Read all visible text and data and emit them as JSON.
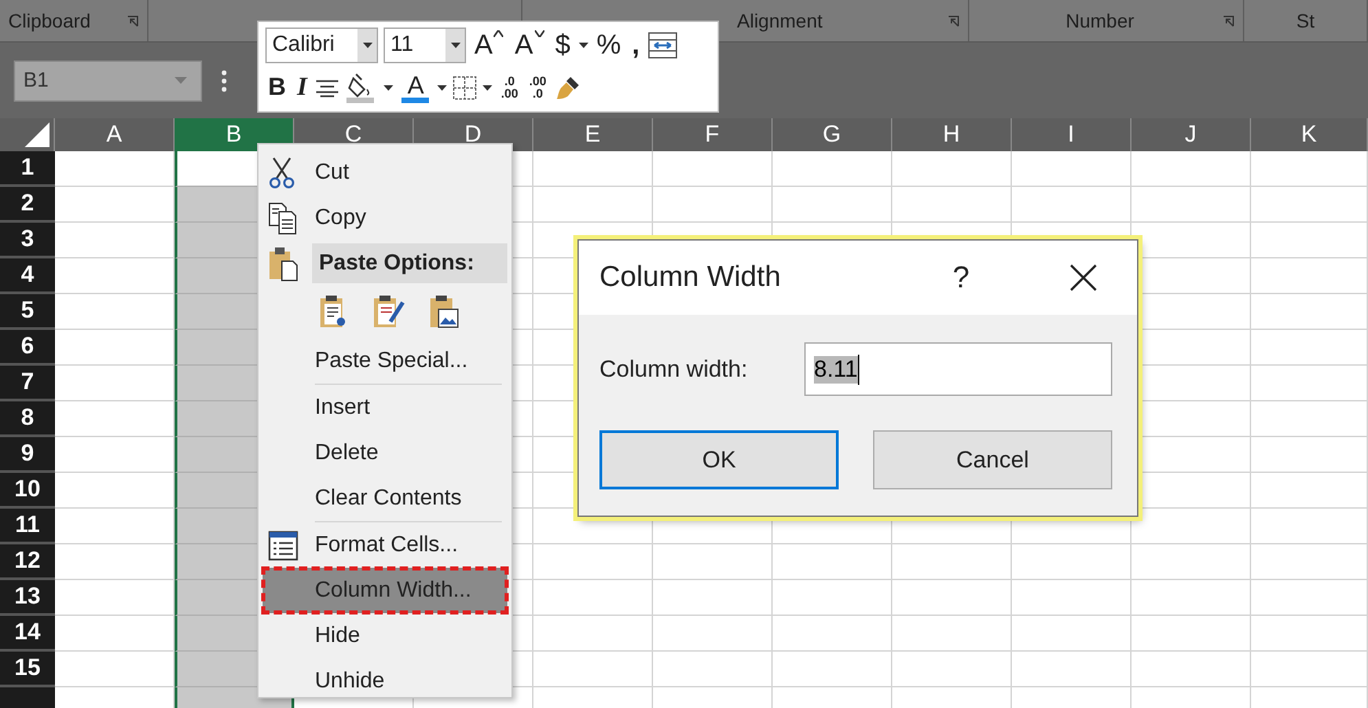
{
  "ribbon_groups": [
    {
      "label": "Clipboard",
      "launcher": true
    },
    {
      "label": "Alignment",
      "launcher": true
    },
    {
      "label": "Number",
      "launcher": true
    },
    {
      "label": "St",
      "launcher": false
    }
  ],
  "name_box": {
    "value": "B1"
  },
  "mini_toolbar": {
    "font": "Calibri",
    "size": "11",
    "grow_font": "A",
    "shrink_font": "A",
    "currency": "$",
    "percent": "%",
    "comma": ",",
    "bold": "B",
    "italic": "I",
    "font_color": "A",
    "increase_decimal": {
      "top": ".0",
      "bottom": ".00"
    },
    "decrease_decimal": {
      "top": ".00",
      "bottom": ".0"
    }
  },
  "columns": [
    {
      "label": "A",
      "selected": false
    },
    {
      "label": "B",
      "selected": true
    },
    {
      "label": "C",
      "selected": false
    },
    {
      "label": "D",
      "selected": false
    },
    {
      "label": "E",
      "selected": false
    },
    {
      "label": "F",
      "selected": false
    },
    {
      "label": "G",
      "selected": false
    },
    {
      "label": "H",
      "selected": false
    },
    {
      "label": "I",
      "selected": false
    },
    {
      "label": "J",
      "selected": false
    },
    {
      "label": "K",
      "selected": false
    }
  ],
  "rows": [
    {
      "label": "1",
      "active": true
    },
    {
      "label": "2",
      "active": false
    },
    {
      "label": "3",
      "active": false
    },
    {
      "label": "4",
      "active": false
    },
    {
      "label": "5",
      "active": false
    },
    {
      "label": "6",
      "active": false
    },
    {
      "label": "7",
      "active": false
    },
    {
      "label": "8",
      "active": false
    },
    {
      "label": "9",
      "active": false
    },
    {
      "label": "10",
      "active": false
    },
    {
      "label": "11",
      "active": false
    },
    {
      "label": "12",
      "active": false
    },
    {
      "label": "13",
      "active": false
    },
    {
      "label": "14",
      "active": false
    },
    {
      "label": "15",
      "active": false
    }
  ],
  "context_menu": {
    "items": [
      {
        "kind": "cut",
        "label": "Cut",
        "divider_before": false,
        "selected": false
      },
      {
        "kind": "copy",
        "label": "Copy",
        "divider_before": false,
        "selected": false
      },
      {
        "kind": "header",
        "label": "Paste Options:"
      },
      {
        "kind": "pastebar"
      },
      {
        "kind": "plain",
        "label": "Paste Special...",
        "divider_before": false,
        "selected": false
      },
      {
        "kind": "plain",
        "label": "Insert",
        "divider_before": true,
        "selected": false
      },
      {
        "kind": "plain",
        "label": "Delete",
        "divider_before": false,
        "selected": false
      },
      {
        "kind": "plain",
        "label": "Clear Contents",
        "divider_before": false,
        "selected": false
      },
      {
        "kind": "format",
        "label": "Format Cells...",
        "divider_before": true,
        "selected": false
      },
      {
        "kind": "plain",
        "label": "Column Width...",
        "divider_before": false,
        "selected": true
      },
      {
        "kind": "plain",
        "label": "Hide",
        "divider_before": false,
        "selected": false
      },
      {
        "kind": "plain",
        "label": "Unhide",
        "divider_before": false,
        "selected": false
      }
    ]
  },
  "dialog": {
    "title": "Column Width",
    "help": "?",
    "field_label": "Column width:",
    "value": "8.11",
    "value_selected": true,
    "buttons": [
      {
        "label": "OK",
        "focused": true
      },
      {
        "label": "Cancel",
        "focused": false
      }
    ]
  }
}
